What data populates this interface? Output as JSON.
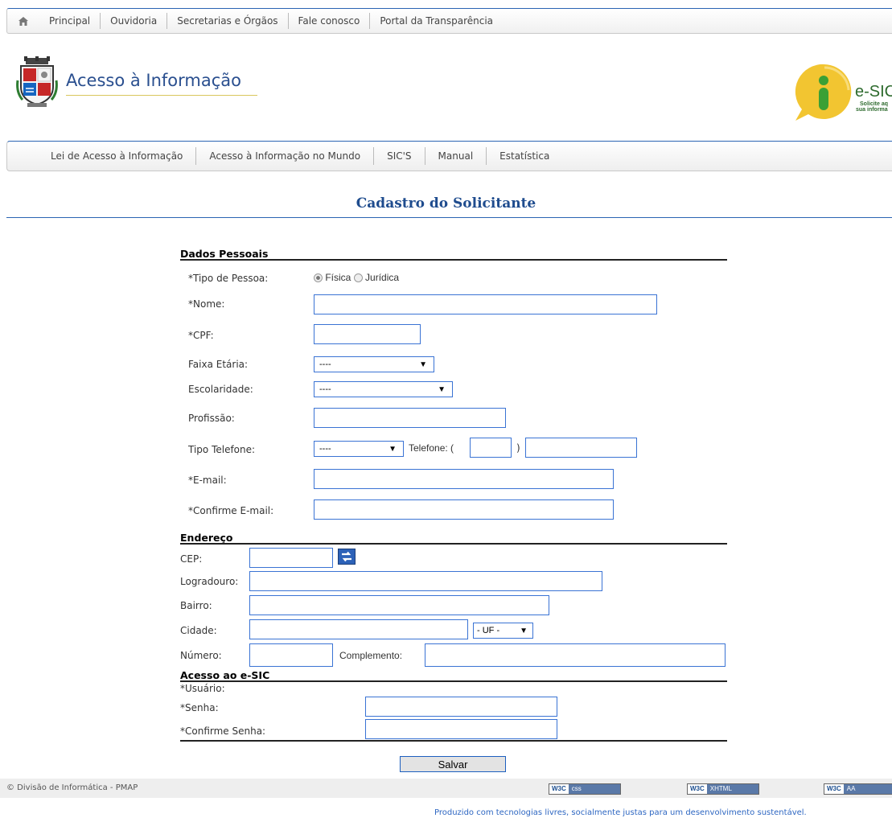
{
  "top_nav": {
    "items": [
      "Principal",
      "Ouvidoria",
      "Secretarias e Órgãos",
      "Fale conosco",
      "Portal da Transparência"
    ]
  },
  "header": {
    "site_title": "Acesso à Informação",
    "esic_logo": {
      "title": "e-SIC",
      "subtitle_line1": "Solicite aq",
      "subtitle_line2": "sua informa"
    }
  },
  "sub_nav": {
    "items": [
      "Lei de Acesso à Informação",
      "Acesso à Informação no Mundo",
      "SIC'S",
      "Manual",
      "Estatística"
    ]
  },
  "page_title": "Cadastro do Solicitante",
  "dados_pessoais": {
    "section_title": "Dados Pessoais",
    "tipo_pessoa_label": "*Tipo de Pessoa:",
    "option_fisica": "Física",
    "option_juridica": "Jurídica",
    "selected": "Física",
    "nome_label": "*Nome:",
    "cpf_label": "*CPF:",
    "faixa_etaria_label": "Faixa Etária:",
    "faixa_etaria_value": "----",
    "escolaridade_label": "Escolaridade:",
    "escolaridade_value": "----",
    "profissao_label": "Profissão:",
    "tipo_telefone_label": "Tipo Telefone:",
    "tipo_telefone_value": "----",
    "telefone_label": "Telefone: (",
    "telefone_close": ")",
    "email_label": "*E-mail:",
    "confirme_email_label": "*Confirme E-mail:"
  },
  "endereco": {
    "section_title": "Endereço",
    "cep_label": "CEP:",
    "logradouro_label": "Logradouro:",
    "bairro_label": "Bairro:",
    "cidade_label": "Cidade:",
    "uf_value": "- UF -",
    "numero_label": "Número:",
    "complemento_label": "Complemento:"
  },
  "acesso": {
    "section_title": "Acesso ao e-SIC",
    "usuario_label": "*Usuário:",
    "senha_label": "*Senha:",
    "confirme_senha_label": "*Confirme Senha:"
  },
  "submit_label": "Salvar",
  "footer": {
    "copyright": "© Divisão de Informática - PMAP",
    "badges": [
      {
        "w3c": "W3C",
        "text": "css"
      },
      {
        "w3c": "W3C",
        "text": "XHTML"
      },
      {
        "w3c": "W3C",
        "text": "AA"
      }
    ],
    "tagline": "Produzido com tecnologias livres, socialmente justas para um desenvolvimento sustentável."
  },
  "icons": [
    "home-icon",
    "coat-of-arms-logo",
    "esic-info-logo",
    "cep-search-icon"
  ],
  "colors": {
    "accent_blue": "#2b64b3",
    "input_border": "#3a73d4",
    "title_blue": "#1f4c8e",
    "esic_yellow": "#f2c531",
    "esic_green": "#3aa035"
  }
}
